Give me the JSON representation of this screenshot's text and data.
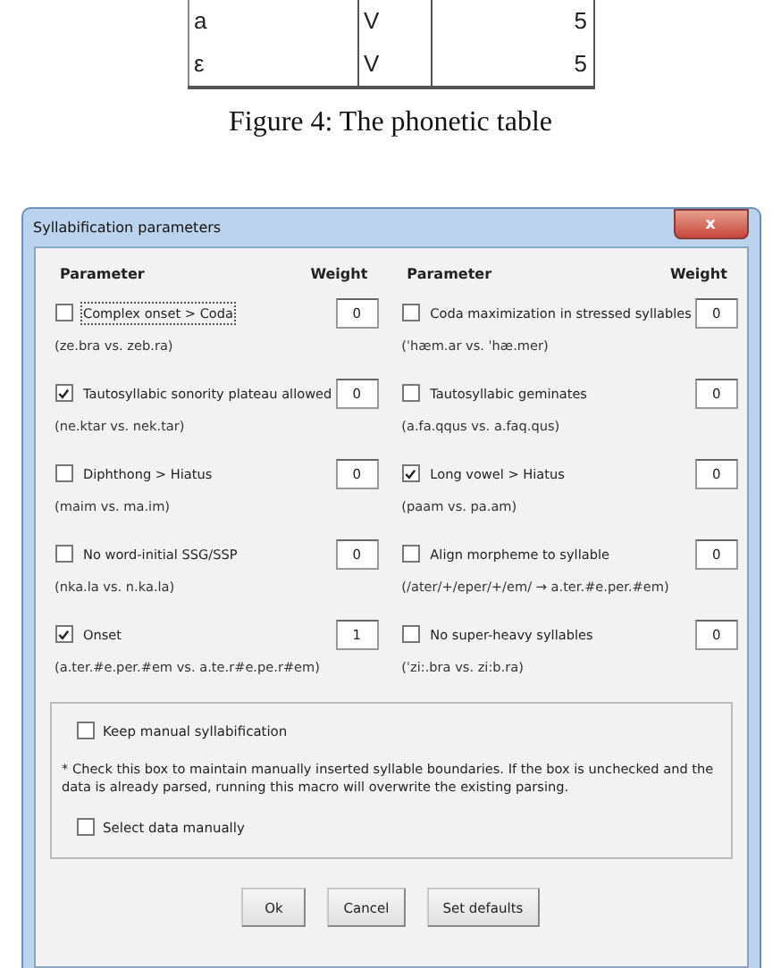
{
  "table_rows": [
    {
      "cells": [
        "a",
        "V",
        "5"
      ]
    },
    {
      "cells": [
        "ε",
        "V",
        "5"
      ]
    }
  ],
  "caption": "Figure 4: The phonetic table",
  "dialog": {
    "title": "Syllabification parameters",
    "close": "x",
    "columns": [
      {
        "header_parameter": "Parameter",
        "header_weight": "Weight",
        "parameters": [
          {
            "label": "Complex onset > Coda",
            "checked": false,
            "focused": true,
            "weight": "0",
            "example": "(ze.bra vs. zeb.ra)"
          },
          {
            "label": "Tautosyllabic sonority plateau allowed",
            "checked": true,
            "focused": false,
            "weight": "0",
            "example": "(ne.ktar vs. nek.tar)"
          },
          {
            "label": "Diphthong > Hiatus",
            "checked": false,
            "focused": false,
            "weight": "0",
            "example": "(maim vs. ma.im)"
          },
          {
            "label": "No word-initial SSG/SSP",
            "checked": false,
            "focused": false,
            "weight": "0",
            "example": "(nka.la vs. n.ka.la)"
          },
          {
            "label": "Onset",
            "checked": true,
            "focused": false,
            "weight": "1",
            "example": "(a.ter.#e.per.#em vs. a.te.r#e.pe.r#em)"
          }
        ]
      },
      {
        "header_parameter": "Parameter",
        "header_weight": "Weight",
        "parameters": [
          {
            "label": "Coda maximization in stressed syllables",
            "checked": false,
            "focused": false,
            "weight": "0",
            "example": "(ˈhæm.ar vs. ˈhæ.mer)"
          },
          {
            "label": "Tautosyllabic geminates",
            "checked": false,
            "focused": false,
            "weight": "0",
            "example": "(a.fa.qqus vs. a.faq.qus)"
          },
          {
            "label": "Long vowel > Hiatus",
            "checked": true,
            "focused": false,
            "weight": "0",
            "example": "(paam vs. pa.am)"
          },
          {
            "label": "Align morpheme to syllable",
            "checked": false,
            "focused": false,
            "weight": "0",
            "example": "(/ater/+/eper/+/em/ → a.ter.#e.per.#em)"
          },
          {
            "label": "No super-heavy syllables",
            "checked": false,
            "focused": false,
            "weight": "0",
            "example": "(ˈzi:.bra vs. zi:b.ra)"
          }
        ]
      }
    ],
    "keep_manual": {
      "label": "Keep manual syllabification",
      "checked": false
    },
    "note": "* Check this box to maintain manually inserted syllable boundaries. If the box is unchecked and the data is already parsed, running this macro will overwrite the existing parsing.",
    "select_manually": {
      "label": "Select data manually",
      "checked": false
    },
    "buttons": [
      "Ok",
      "Cancel",
      "Set defaults"
    ]
  }
}
